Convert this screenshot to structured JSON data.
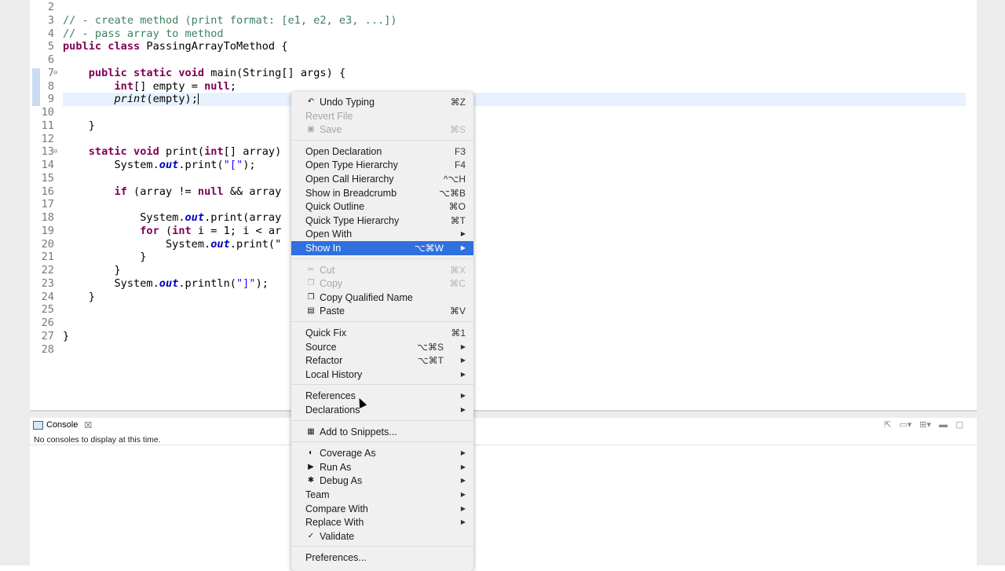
{
  "editor": {
    "lines": [
      {
        "n": "2",
        "parts": []
      },
      {
        "n": "3",
        "parts": [
          {
            "t": "// - create method (print format: [e1, e2, e3, ...])",
            "c": "cm"
          }
        ]
      },
      {
        "n": "4",
        "parts": [
          {
            "t": "// - pass array to method",
            "c": "cm"
          }
        ]
      },
      {
        "n": "5",
        "parts": [
          {
            "t": "public class",
            "c": "kw"
          },
          {
            "t": " PassingArrayToMethod {",
            "c": ""
          }
        ]
      },
      {
        "n": "6",
        "parts": []
      },
      {
        "n": "7",
        "fold": true,
        "parts": [
          {
            "t": "    ",
            "c": ""
          },
          {
            "t": "public static void",
            "c": "kw"
          },
          {
            "t": " main(String[] args) {",
            "c": ""
          }
        ]
      },
      {
        "n": "8",
        "parts": [
          {
            "t": "        ",
            "c": ""
          },
          {
            "t": "int",
            "c": "kw"
          },
          {
            "t": "[] empty = ",
            "c": ""
          },
          {
            "t": "null",
            "c": "kw"
          },
          {
            "t": ";",
            "c": ""
          }
        ]
      },
      {
        "n": "9",
        "parts": [
          {
            "t": "        ",
            "c": ""
          },
          {
            "t": "print",
            "c": "it"
          },
          {
            "t": "(empty);",
            "c": ""
          }
        ],
        "caret": true
      },
      {
        "n": "10",
        "parts": []
      },
      {
        "n": "11",
        "parts": [
          {
            "t": "    }",
            "c": ""
          }
        ]
      },
      {
        "n": "12",
        "parts": []
      },
      {
        "n": "13",
        "fold": true,
        "parts": [
          {
            "t": "    ",
            "c": ""
          },
          {
            "t": "static void",
            "c": "kw"
          },
          {
            "t": " print(",
            "c": ""
          },
          {
            "t": "int",
            "c": "kw"
          },
          {
            "t": "[] array)",
            "c": ""
          }
        ]
      },
      {
        "n": "14",
        "parts": [
          {
            "t": "        System.",
            "c": ""
          },
          {
            "t": "out",
            "c": "sf"
          },
          {
            "t": ".print(",
            "c": ""
          },
          {
            "t": "\"[\"",
            "c": "st"
          },
          {
            "t": ");",
            "c": ""
          }
        ]
      },
      {
        "n": "15",
        "parts": []
      },
      {
        "n": "16",
        "parts": [
          {
            "t": "        ",
            "c": ""
          },
          {
            "t": "if",
            "c": "kw"
          },
          {
            "t": " (array != ",
            "c": ""
          },
          {
            "t": "null",
            "c": "kw"
          },
          {
            "t": " && array",
            "c": ""
          }
        ]
      },
      {
        "n": "17",
        "parts": []
      },
      {
        "n": "18",
        "parts": [
          {
            "t": "            System.",
            "c": ""
          },
          {
            "t": "out",
            "c": "sf"
          },
          {
            "t": ".print(array",
            "c": ""
          }
        ]
      },
      {
        "n": "19",
        "parts": [
          {
            "t": "            ",
            "c": ""
          },
          {
            "t": "for",
            "c": "kw"
          },
          {
            "t": " (",
            "c": ""
          },
          {
            "t": "int",
            "c": "kw"
          },
          {
            "t": " i = 1; i < ar",
            "c": ""
          }
        ]
      },
      {
        "n": "20",
        "parts": [
          {
            "t": "                System.",
            "c": ""
          },
          {
            "t": "out",
            "c": "sf"
          },
          {
            "t": ".print(\"",
            "c": ""
          }
        ]
      },
      {
        "n": "21",
        "parts": [
          {
            "t": "            }",
            "c": ""
          }
        ]
      },
      {
        "n": "22",
        "parts": [
          {
            "t": "        }",
            "c": ""
          }
        ]
      },
      {
        "n": "23",
        "parts": [
          {
            "t": "        System.",
            "c": ""
          },
          {
            "t": "out",
            "c": "sf"
          },
          {
            "t": ".println(",
            "c": ""
          },
          {
            "t": "\"]\"",
            "c": "st"
          },
          {
            "t": ");",
            "c": ""
          }
        ]
      },
      {
        "n": "24",
        "parts": [
          {
            "t": "    }",
            "c": ""
          }
        ]
      },
      {
        "n": "25",
        "parts": []
      },
      {
        "n": "26",
        "parts": []
      },
      {
        "n": "27",
        "parts": [
          {
            "t": "}",
            "c": ""
          }
        ]
      },
      {
        "n": "28",
        "parts": []
      }
    ]
  },
  "console": {
    "tab_label": "Console",
    "message": "No consoles to display at this time."
  },
  "menu": {
    "items": [
      {
        "label": "Undo Typing",
        "shortcut": "⌘Z",
        "icon": "undo-icon",
        "glyph": "↶"
      },
      {
        "label": "Revert File",
        "shortcut": "",
        "disabled": true
      },
      {
        "label": "Save",
        "shortcut": "⌘S",
        "icon": "save-icon",
        "glyph": "▣",
        "disabled": true
      },
      {
        "sep": true
      },
      {
        "label": "Open Declaration",
        "shortcut": "F3"
      },
      {
        "label": "Open Type Hierarchy",
        "shortcut": "F4"
      },
      {
        "label": "Open Call Hierarchy",
        "shortcut": "^⌥H"
      },
      {
        "label": "Show in Breadcrumb",
        "shortcut": "⌥⌘B"
      },
      {
        "label": "Quick Outline",
        "shortcut": "⌘O"
      },
      {
        "label": "Quick Type Hierarchy",
        "shortcut": "⌘T"
      },
      {
        "label": "Open With",
        "submenu": true
      },
      {
        "label": "Show In",
        "shortcut": "⌥⌘W",
        "submenu": true,
        "selected": true
      },
      {
        "sep": true
      },
      {
        "label": "Cut",
        "shortcut": "⌘X",
        "icon": "cut-icon",
        "glyph": "✂",
        "disabled": true
      },
      {
        "label": "Copy",
        "shortcut": "⌘C",
        "icon": "copy-icon",
        "glyph": "❐",
        "disabled": true
      },
      {
        "label": "Copy Qualified Name",
        "shortcut": "",
        "icon": "copy-qualified-name-icon",
        "glyph": "❐"
      },
      {
        "label": "Paste",
        "shortcut": "⌘V",
        "icon": "paste-icon",
        "glyph": "▤"
      },
      {
        "sep": true
      },
      {
        "label": "Quick Fix",
        "shortcut": "⌘1"
      },
      {
        "label": "Source",
        "shortcut": "⌥⌘S",
        "submenu": true
      },
      {
        "label": "Refactor",
        "shortcut": "⌥⌘T",
        "submenu": true
      },
      {
        "label": "Local History",
        "submenu": true
      },
      {
        "sep": true
      },
      {
        "label": "References",
        "submenu": true
      },
      {
        "label": "Declarations",
        "submenu": true
      },
      {
        "sep": true
      },
      {
        "label": "Add to Snippets...",
        "icon": "snippets-icon",
        "glyph": "▦"
      },
      {
        "sep": true
      },
      {
        "label": "Coverage As",
        "submenu": true,
        "icon": "coverage-icon",
        "glyph": "◐"
      },
      {
        "label": "Run As",
        "submenu": true,
        "icon": "run-icon",
        "glyph": "▶"
      },
      {
        "label": "Debug As",
        "submenu": true,
        "icon": "debug-icon",
        "glyph": "✱"
      },
      {
        "label": "Team",
        "submenu": true
      },
      {
        "label": "Compare With",
        "submenu": true
      },
      {
        "label": "Replace With",
        "submenu": true
      },
      {
        "label": "Validate",
        "icon": "checkbox-icon",
        "glyph": "✓"
      },
      {
        "sep": true
      },
      {
        "label": "Preferences..."
      }
    ]
  },
  "colors": {
    "selection": "#2f6fe0",
    "keyword": "#7f0055",
    "comment": "#3f7f5f",
    "string": "#2a00ff",
    "static_field": "#0000c0"
  }
}
